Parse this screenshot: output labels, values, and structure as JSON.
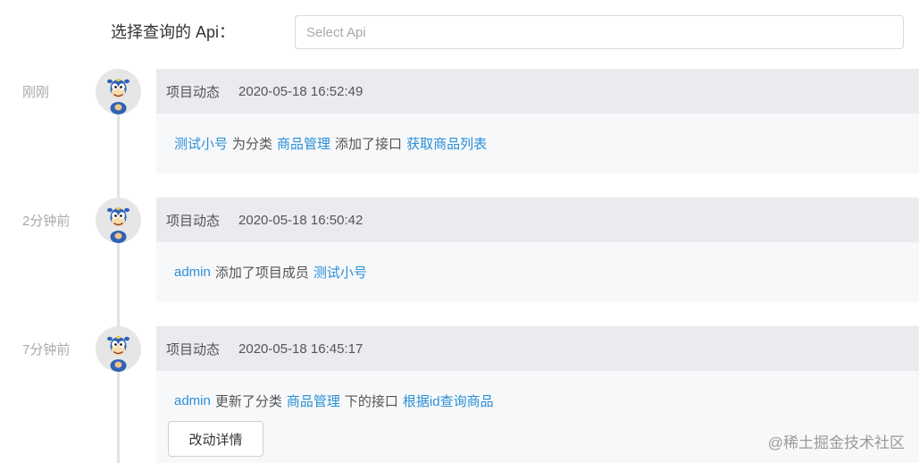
{
  "filter": {
    "label": "选择查询的 Api：",
    "placeholder": "Select Api"
  },
  "entries": [
    {
      "time_ago": "刚刚",
      "type": "项目动态",
      "timestamp": "2020-05-18 16:52:49",
      "parts": [
        {
          "kind": "link",
          "text": "测试小号"
        },
        {
          "kind": "text",
          "text": "为分类"
        },
        {
          "kind": "link",
          "text": "商品管理"
        },
        {
          "kind": "text",
          "text": "添加了接口"
        },
        {
          "kind": "link",
          "text": "获取商品列表"
        }
      ]
    },
    {
      "time_ago": "2分钟前",
      "type": "项目动态",
      "timestamp": "2020-05-18 16:50:42",
      "parts": [
        {
          "kind": "link",
          "text": "admin"
        },
        {
          "kind": "text",
          "text": "添加了项目成员"
        },
        {
          "kind": "link",
          "text": "测试小号"
        }
      ]
    },
    {
      "time_ago": "7分钟前",
      "type": "项目动态",
      "timestamp": "2020-05-18 16:45:17",
      "parts": [
        {
          "kind": "link",
          "text": "admin"
        },
        {
          "kind": "text",
          "text": "更新了分类"
        },
        {
          "kind": "link",
          "text": "商品管理"
        },
        {
          "kind": "text",
          "text": "下的接口"
        },
        {
          "kind": "link",
          "text": "根据id查询商品"
        }
      ],
      "detail_button": "改动详情"
    }
  ],
  "watermark": "@稀土掘金技术社区",
  "colors": {
    "link": "#2b8fd6",
    "card_header": "#eaebef",
    "card_body": "#f7f8fa",
    "timeline": "#e2e2e2"
  },
  "icons": {
    "avatar": "cartoon-cow-avatar-icon"
  }
}
